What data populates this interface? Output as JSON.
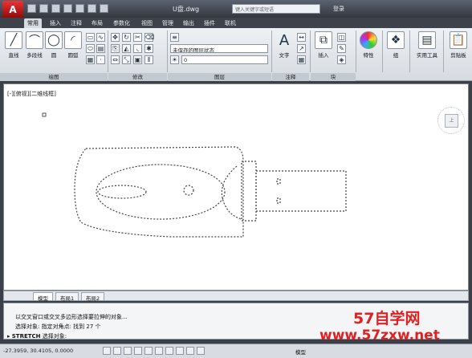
{
  "titlebar": {
    "app_button_label": "A",
    "title": "U盘.dwg",
    "search_placeholder": "键入关键字或短语",
    "login_label": "登录"
  },
  "ribbon_tabs": [
    "常用",
    "插入",
    "注释",
    "布局",
    "参数化",
    "视图",
    "管理",
    "输出",
    "插件",
    "联机"
  ],
  "ribbon": {
    "draw_tools": [
      "直线",
      "多段线",
      "圆",
      "圆弧"
    ],
    "layer_state": "未保存的图层状态",
    "layer_current": "0",
    "text_label": "文字",
    "insert_label": "插入",
    "properties_label": "特性",
    "group_label": "组",
    "utilities_label": "实用工具",
    "clipboard_label": "剪贴板",
    "panels": {
      "draw": "绘图",
      "modify": "修改",
      "layers": "图层",
      "annotation": "注释",
      "block": "块"
    }
  },
  "viewport": {
    "label": "[-][俯视][二维线框]",
    "viewcube_face": "上"
  },
  "layout_tabs": [
    "模型",
    "布局1",
    "布局2"
  ],
  "command": {
    "history_1": "以交叉窗口或交叉多边形选择要拉伸的对象...",
    "history_2": "选择对象: 指定对角点: 找到 27 个",
    "prompt_command": "STRETCH",
    "prompt_text": "选择对象:"
  },
  "status": {
    "coordinates": "-27.3959, 30.4105, 0.0000",
    "model_label": "模型"
  },
  "watermark": {
    "logo": "57自学网",
    "url": "www.57zxw.net"
  },
  "colors": {
    "accent_red": "#e02020",
    "titlebar": "#33383f",
    "ribbon": "#e3e7ec"
  }
}
